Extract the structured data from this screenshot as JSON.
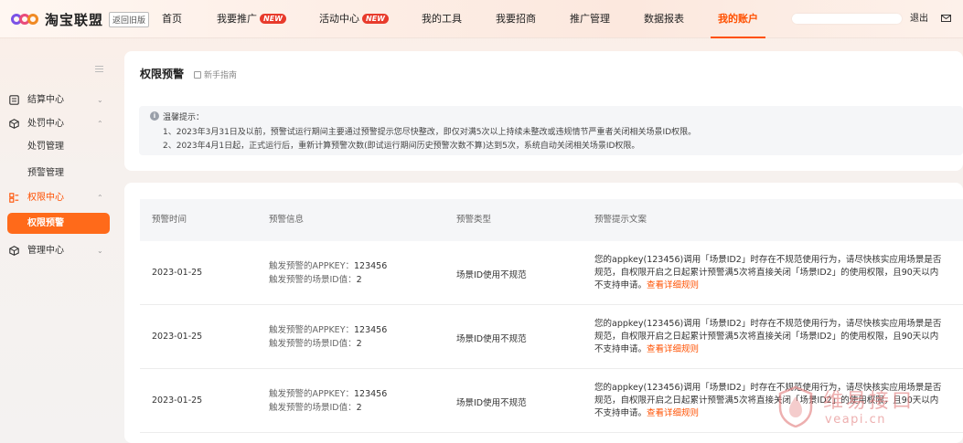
{
  "header": {
    "logo_text": "淘宝联盟",
    "old_version_label": "返回旧版",
    "nav": [
      {
        "label": "首页",
        "badge": ""
      },
      {
        "label": "我要推广",
        "badge": "NEW"
      },
      {
        "label": "活动中心",
        "badge": "NEW"
      },
      {
        "label": "我的工具",
        "badge": ""
      },
      {
        "label": "我要招商",
        "badge": ""
      },
      {
        "label": "推广管理",
        "badge": ""
      },
      {
        "label": "数据报表",
        "badge": ""
      },
      {
        "label": "我的账户",
        "badge": "",
        "active": true
      }
    ],
    "logout_label": "退出",
    "accent_color": "#ff5000"
  },
  "sidebar": {
    "groups": [
      {
        "label": "结算中心",
        "icon": "ledger-icon",
        "expanded": false
      },
      {
        "label": "处罚中心",
        "icon": "cube-icon",
        "expanded": true,
        "items": [
          {
            "label": "处罚管理"
          },
          {
            "label": "预警管理"
          }
        ]
      },
      {
        "label": "权限中心",
        "icon": "permission-icon",
        "expanded": true,
        "active": true,
        "items": [
          {
            "label": "权限预警",
            "active": true
          }
        ]
      },
      {
        "label": "管理中心",
        "icon": "cube-icon",
        "expanded": false
      }
    ]
  },
  "page": {
    "title": "权限预警",
    "guide_label": "新手指南",
    "notice": {
      "title": "温馨提示：",
      "lines": [
        "1、2023年3月31日及以前，预警试运行期间主要通过预警提示您尽快整改，即仅对满5次以上持续未整改或违规情节严重者关闭相关场景ID权限。",
        "2、2023年4月1日起，正式运行后，重新计算预警次数(即试运行期间历史预警次数不算)达到5次，系统自动关闭相关场景ID权限。"
      ]
    },
    "table": {
      "columns": [
        "预警时间",
        "预警信息",
        "预警类型",
        "预警提示文案"
      ],
      "rows": [
        {
          "time": "2023-01-25",
          "appkey_label": "触发预警的APPKEY：",
          "appkey": "123456",
          "scene_label": "触发预警的场景ID值：",
          "scene": "2",
          "type": "场景ID使用不规范",
          "message": "您的appkey(123456)调用「场景ID2」时存在不规范使用行为，请尽快核实应用场景是否规范，自权限开启之日起累计预警满5次将直接关闭「场景ID2」的使用权限，且90天以内不支持申请。",
          "link": "查看详细规则"
        },
        {
          "time": "2023-01-25",
          "appkey_label": "触发预警的APPKEY：",
          "appkey": "123456",
          "scene_label": "触发预警的场景ID值：",
          "scene": "2",
          "type": "场景ID使用不规范",
          "message": "您的appkey(123456)调用「场景ID2」时存在不规范使用行为，请尽快核实应用场景是否规范，自权限开启之日起累计预警满5次将直接关闭「场景ID2」的使用权限，且90天以内不支持申请。",
          "link": "查看详细规则"
        },
        {
          "time": "2023-01-25",
          "appkey_label": "触发预警的APPKEY：",
          "appkey": "123456",
          "scene_label": "触发预警的场景ID值：",
          "scene": "2",
          "type": "场景ID使用不规范",
          "message": "您的appkey(123456)调用「场景ID2」时存在不规范使用行为，请尽快核实应用场景是否规范，自权限开启之日起累计预警满5次将直接关闭「场景ID2」的使用权限，且90天以内不支持申请。",
          "link": "查看详细规则"
        }
      ]
    }
  },
  "watermark": {
    "line1": "维易接口",
    "line2": "veapi.cn"
  }
}
